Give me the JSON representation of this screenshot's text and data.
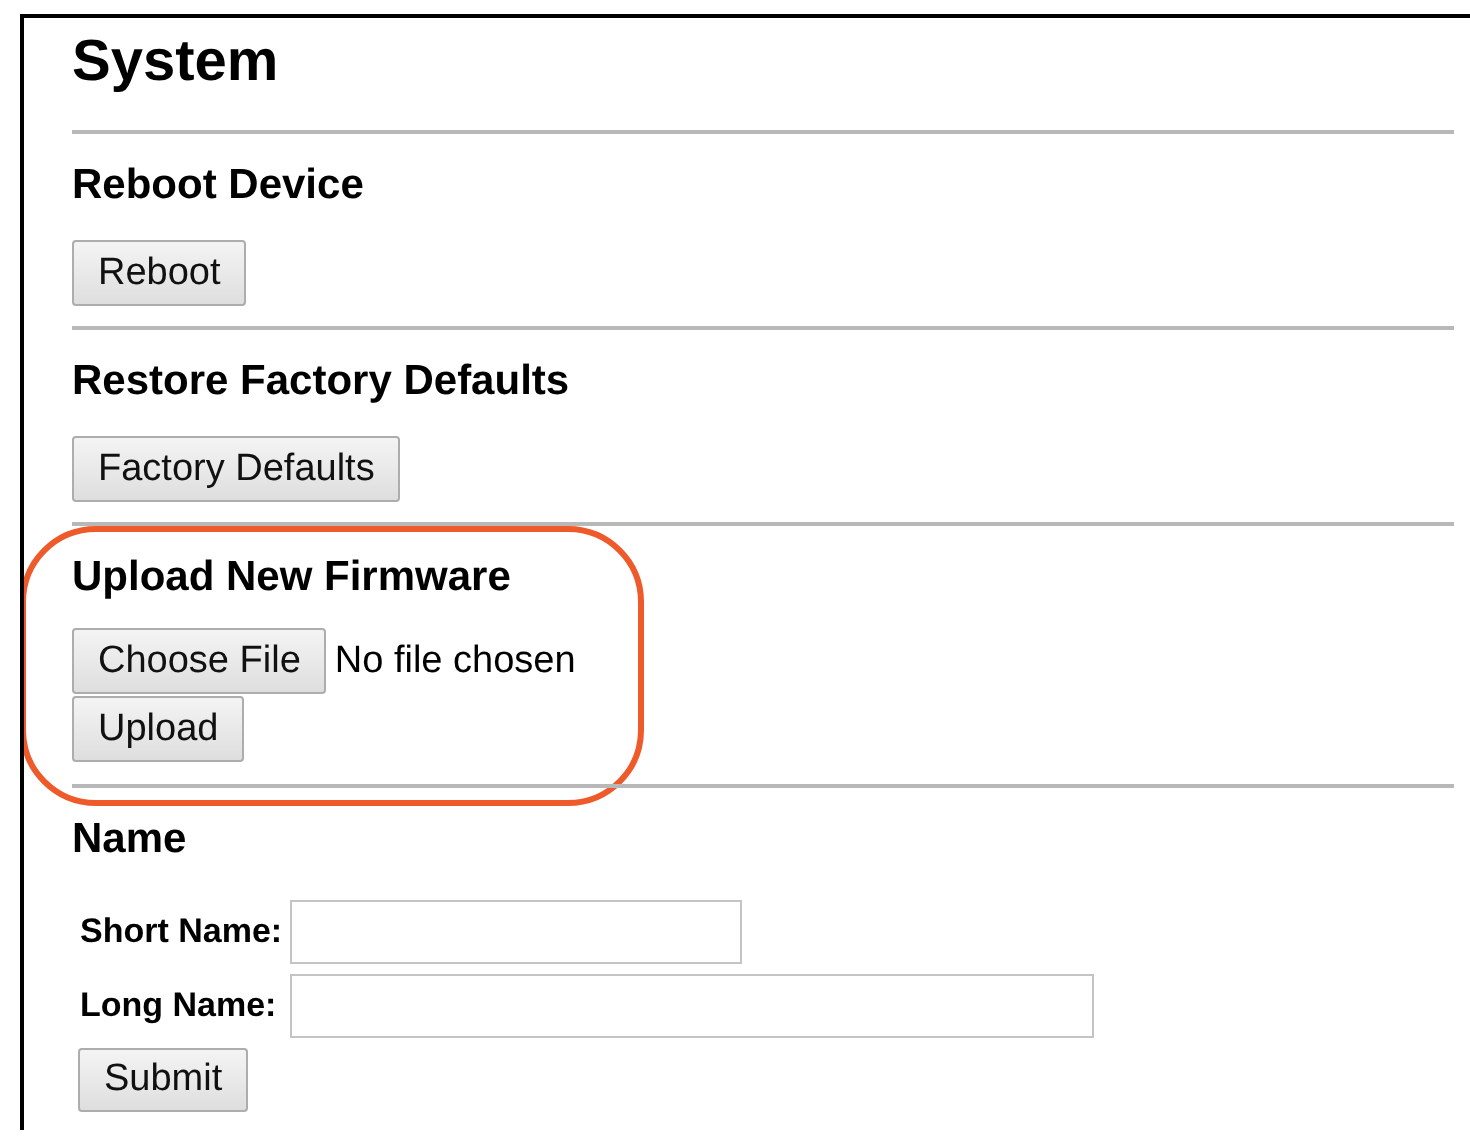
{
  "page": {
    "title": "System"
  },
  "sections": [
    {
      "kind": "button",
      "heading": "Reboot Device",
      "button": "Reboot"
    },
    {
      "kind": "button",
      "heading": "Restore Factory Defaults",
      "button": "Factory Defaults"
    },
    {
      "kind": "upload",
      "heading": "Upload New Firmware",
      "choose_button": "Choose File",
      "file_status": "No file chosen",
      "button": "Upload",
      "highlighted": true
    },
    {
      "kind": "form",
      "heading": "Name",
      "fields": [
        {
          "label": "Short Name:"
        },
        {
          "label": "Long Name:"
        }
      ],
      "button": "Submit"
    }
  ]
}
